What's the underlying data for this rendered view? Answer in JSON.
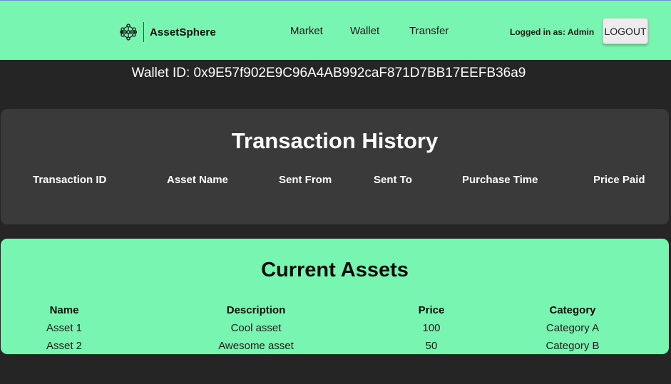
{
  "header": {
    "brand": "AssetSphere",
    "nav": [
      "Market",
      "Wallet",
      "Transfer"
    ],
    "login_text": "Logged in as: Admin",
    "logout_label": "LOGOUT",
    "bg_color": "#78f5b0"
  },
  "wallet": {
    "label": "Wallet ID: 0x9E57f902E9C96A4AB992caF871D7BB17EEFB36a9"
  },
  "transaction_history": {
    "title": "Transaction History",
    "columns": [
      "Transaction ID",
      "Asset Name",
      "Sent From",
      "Sent To",
      "Purchase Time",
      "Price Paid"
    ],
    "rows": []
  },
  "current_assets": {
    "title": "Current Assets",
    "columns": [
      "Name",
      "Description",
      "Price",
      "Category"
    ],
    "rows": [
      [
        "Asset 1",
        "Cool asset",
        "100",
        "Category A"
      ],
      [
        "Asset 2",
        "Awesome asset",
        "50",
        "Category B"
      ]
    ]
  }
}
